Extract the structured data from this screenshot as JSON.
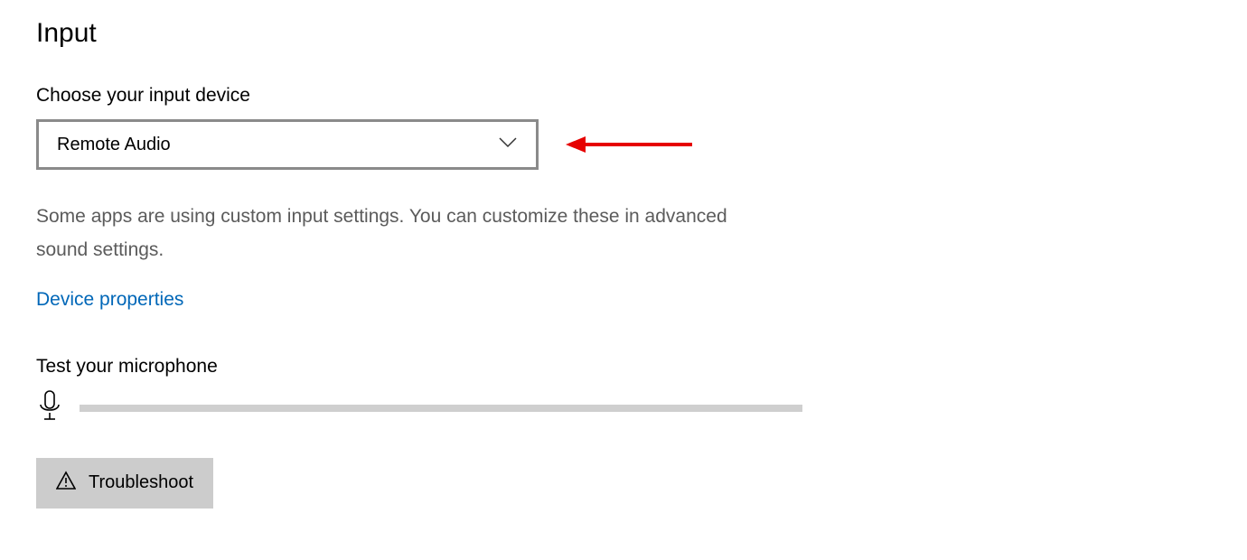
{
  "section": {
    "title": "Input"
  },
  "input_device": {
    "label": "Choose your input device",
    "selected": "Remote Audio"
  },
  "info": {
    "text": "Some apps are using custom input settings. You can customize these in advanced sound settings."
  },
  "link": {
    "device_properties": "Device properties"
  },
  "mic_test": {
    "label": "Test your microphone"
  },
  "troubleshoot": {
    "label": "Troubleshoot"
  }
}
